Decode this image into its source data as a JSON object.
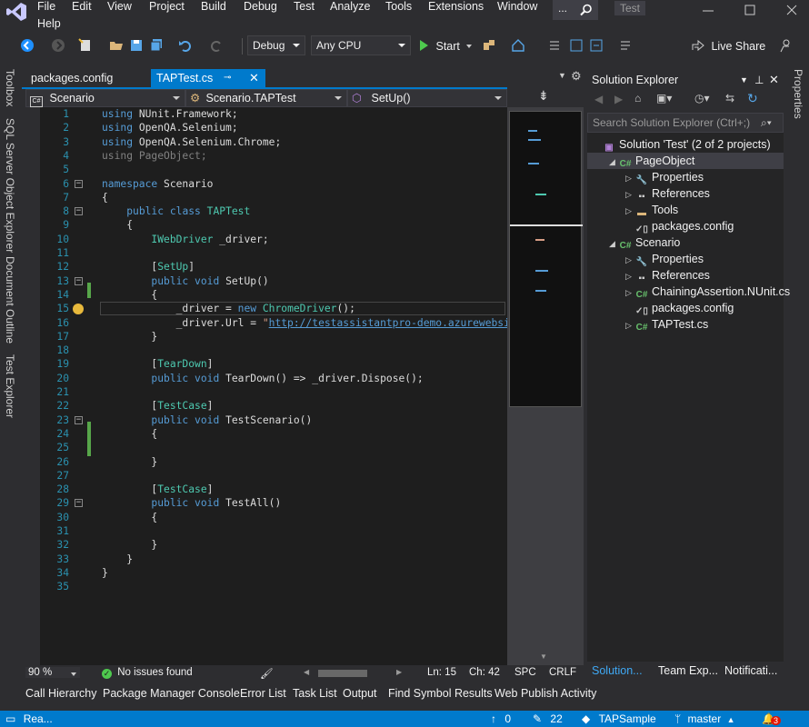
{
  "menu": [
    "File",
    "Edit",
    "View",
    "Project",
    "Build",
    "Debug",
    "Test",
    "Analyze",
    "Tools",
    "Extensions",
    "Window",
    "Help"
  ],
  "title_search_label": "...",
  "window_title": "Test",
  "toolbar": {
    "config": "Debug",
    "platform": "Any CPU",
    "start_label": "Start",
    "live_share_label": "Live Share"
  },
  "left_strip": [
    "Toolbox",
    "SQL Server Object Explorer",
    "Document Outline",
    "Test Explorer"
  ],
  "right_strip": [
    "Properties"
  ],
  "doc_tabs": [
    "packages.config",
    "TAPTest.cs"
  ],
  "nav": {
    "project": "Scenario",
    "class": "Scenario.TAPTest",
    "member": "SetUp()"
  },
  "code": [
    {
      "n": "1",
      "parts": [
        [
          "kw",
          "using"
        ],
        [
          "",
          " NUnit.Framework;"
        ]
      ]
    },
    {
      "n": "2",
      "parts": [
        [
          "kw",
          "using"
        ],
        [
          "",
          " OpenQA.Selenium;"
        ]
      ]
    },
    {
      "n": "3",
      "parts": [
        [
          "kw",
          "using"
        ],
        [
          "",
          " OpenQA.Selenium.Chrome;"
        ]
      ]
    },
    {
      "n": "4",
      "parts": [
        [
          "dim",
          "using"
        ],
        [
          "dim",
          " PageObject;"
        ]
      ]
    },
    {
      "n": "5",
      "parts": []
    },
    {
      "n": "6",
      "parts": [
        [
          "kw",
          "namespace"
        ],
        [
          "",
          " Scenario"
        ]
      ]
    },
    {
      "n": "7",
      "parts": [
        [
          "",
          "{"
        ]
      ]
    },
    {
      "n": "8",
      "parts": [
        [
          "",
          "    "
        ],
        [
          "kw",
          "public"
        ],
        [
          "",
          " "
        ],
        [
          "kw",
          "class"
        ],
        [
          "",
          " "
        ],
        [
          "ty",
          "TAPTest"
        ]
      ]
    },
    {
      "n": "9",
      "parts": [
        [
          "",
          "    {"
        ]
      ]
    },
    {
      "n": "10",
      "parts": [
        [
          "",
          "        "
        ],
        [
          "ty",
          "IWebDriver"
        ],
        [
          "",
          " _driver;"
        ]
      ]
    },
    {
      "n": "11",
      "parts": []
    },
    {
      "n": "12",
      "parts": [
        [
          "",
          "        ["
        ],
        [
          "attr",
          "SetUp"
        ],
        [
          "",
          "]"
        ]
      ]
    },
    {
      "n": "13",
      "parts": [
        [
          "",
          "        "
        ],
        [
          "kw",
          "public"
        ],
        [
          "",
          " "
        ],
        [
          "kw",
          "void"
        ],
        [
          "",
          " SetUp()"
        ]
      ]
    },
    {
      "n": "14",
      "parts": [
        [
          "",
          "        {"
        ]
      ]
    },
    {
      "n": "15",
      "parts": [
        [
          "",
          "            _driver = "
        ],
        [
          "kw",
          "new"
        ],
        [
          "",
          " "
        ],
        [
          "ty",
          "ChromeDriver"
        ],
        [
          "",
          "();"
        ]
      ]
    },
    {
      "n": "16",
      "parts": [
        [
          "",
          "            _driver.Url = "
        ],
        [
          "str",
          "\""
        ],
        [
          "url",
          "http://testassistantpro-demo.azurewebsites"
        ]
      ]
    },
    {
      "n": "17",
      "parts": [
        [
          "",
          "        }"
        ]
      ]
    },
    {
      "n": "18",
      "parts": []
    },
    {
      "n": "19",
      "parts": [
        [
          "",
          "        ["
        ],
        [
          "attr",
          "TearDown"
        ],
        [
          "",
          "]"
        ]
      ]
    },
    {
      "n": "20",
      "parts": [
        [
          "",
          "        "
        ],
        [
          "kw",
          "public"
        ],
        [
          "",
          " "
        ],
        [
          "kw",
          "void"
        ],
        [
          "",
          " TearDown() => _driver.Dispose();"
        ]
      ]
    },
    {
      "n": "21",
      "parts": []
    },
    {
      "n": "22",
      "parts": [
        [
          "",
          "        ["
        ],
        [
          "attr",
          "TestCase"
        ],
        [
          "",
          "]"
        ]
      ]
    },
    {
      "n": "23",
      "parts": [
        [
          "",
          "        "
        ],
        [
          "kw",
          "public"
        ],
        [
          "",
          " "
        ],
        [
          "kw",
          "void"
        ],
        [
          "",
          " TestScenario()"
        ]
      ]
    },
    {
      "n": "24",
      "parts": [
        [
          "",
          "        {"
        ]
      ]
    },
    {
      "n": "25",
      "parts": []
    },
    {
      "n": "26",
      "parts": [
        [
          "",
          "        }"
        ]
      ]
    },
    {
      "n": "27",
      "parts": []
    },
    {
      "n": "28",
      "parts": [
        [
          "",
          "        ["
        ],
        [
          "attr",
          "TestCase"
        ],
        [
          "",
          "]"
        ]
      ]
    },
    {
      "n": "29",
      "parts": [
        [
          "",
          "        "
        ],
        [
          "kw",
          "public"
        ],
        [
          "",
          " "
        ],
        [
          "kw",
          "void"
        ],
        [
          "",
          " TestAll()"
        ]
      ]
    },
    {
      "n": "30",
      "parts": [
        [
          "",
          "        {"
        ]
      ]
    },
    {
      "n": "31",
      "parts": []
    },
    {
      "n": "32",
      "parts": [
        [
          "",
          "        }"
        ]
      ]
    },
    {
      "n": "33",
      "parts": [
        [
          "",
          "    }"
        ]
      ]
    },
    {
      "n": "34",
      "parts": [
        [
          "",
          "}"
        ]
      ]
    },
    {
      "n": "35",
      "parts": []
    }
  ],
  "editor_status": {
    "zoom": "90 %",
    "issues": "No issues found",
    "line": "Ln: 15",
    "col": "Ch: 42",
    "spc": "SPC",
    "eol": "CRLF"
  },
  "solution_explorer": {
    "title": "Solution Explorer",
    "search_placeholder": "Search Solution Explorer (Ctrl+;)",
    "tree": [
      {
        "label": "Solution 'Test' (2 of 2 projects)",
        "icon": "solution-icon",
        "depth": 0,
        "exp": ""
      },
      {
        "label": "PageObject",
        "icon": "csharp-project-icon",
        "depth": 1,
        "exp": "◢",
        "selected": true
      },
      {
        "label": "Properties",
        "icon": "wrench-icon",
        "depth": 2,
        "exp": "▷"
      },
      {
        "label": "References",
        "icon": "references-icon",
        "depth": 2,
        "exp": "▷"
      },
      {
        "label": "Tools",
        "icon": "folder-icon",
        "depth": 2,
        "exp": "▷"
      },
      {
        "label": "packages.config",
        "icon": "config-file-icon",
        "depth": 2,
        "exp": ""
      },
      {
        "label": "Scenario",
        "icon": "csharp-project-icon",
        "depth": 1,
        "exp": "◢"
      },
      {
        "label": "Properties",
        "icon": "wrench-icon",
        "depth": 2,
        "exp": "▷"
      },
      {
        "label": "References",
        "icon": "references-icon",
        "depth": 2,
        "exp": "▷"
      },
      {
        "label": "ChainingAssertion.NUnit.cs",
        "icon": "csharp-file-icon",
        "depth": 2,
        "exp": "▷"
      },
      {
        "label": "packages.config",
        "icon": "config-file-icon",
        "depth": 2,
        "exp": ""
      },
      {
        "label": "TAPTest.cs",
        "icon": "csharp-file-icon",
        "depth": 2,
        "exp": "▷"
      }
    ],
    "bottom_tabs": [
      "Solution...",
      "Team Exp...",
      "Notificati..."
    ]
  },
  "bottom_tabs": [
    "Call Hierarchy",
    "Package Manager Console",
    "Error List",
    "Task List",
    "Output",
    "Find Symbol Results",
    "Web Publish Activity"
  ],
  "status": {
    "state": "Rea...",
    "up": "0",
    "edits": "22",
    "repo": "TAPSample",
    "branch": "master",
    "notif": "3"
  }
}
